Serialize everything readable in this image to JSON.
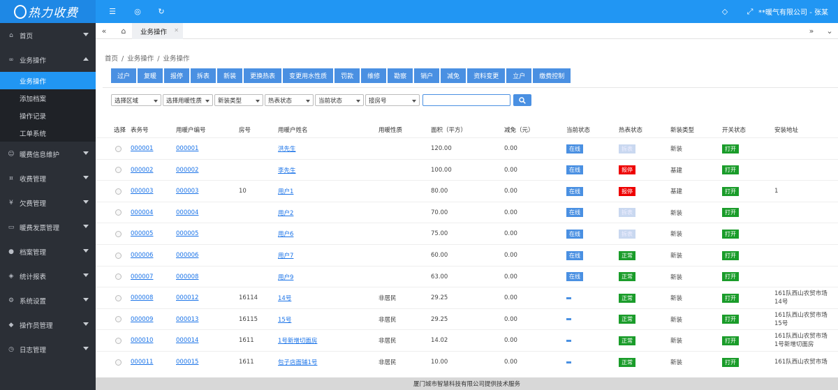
{
  "app": {
    "title": "热力收费",
    "company_user": "**暖气有限公司 - 张某"
  },
  "colors": {
    "primary": "#2196f3",
    "sidebar": "#2b2f36",
    "button": "#4a90e2",
    "danger": "#e00000",
    "success": "#1a9c2a"
  },
  "sidebar": {
    "items": [
      {
        "icon": "home-icon",
        "label": "首页"
      },
      {
        "icon": "link-icon",
        "label": "业务操作"
      },
      {
        "icon": "user-card-icon",
        "label": "暖费信息维护"
      },
      {
        "icon": "coin-icon",
        "label": "收费管理"
      },
      {
        "icon": "debt-icon",
        "label": "欠费管理"
      },
      {
        "icon": "invoice-icon",
        "label": "暖费发票管理"
      },
      {
        "icon": "person-icon",
        "label": "档案管理"
      },
      {
        "icon": "stats-icon",
        "label": "统计报表"
      },
      {
        "icon": "gear-icon",
        "label": "系统设置"
      },
      {
        "icon": "shield-icon",
        "label": "操作员管理"
      },
      {
        "icon": "clock-icon",
        "label": "日志管理"
      }
    ],
    "subitems": [
      "业务操作",
      "添加档案",
      "操作记录",
      "工单系统"
    ]
  },
  "tabbar": {
    "tab_label": "业务操作"
  },
  "breadcrumb": [
    "首页",
    "/",
    "业务操作",
    "/",
    "业务操作"
  ],
  "toolbar": [
    "过户",
    "复暖",
    "报停",
    "拆表",
    "新装",
    "更换热表",
    "变更用水性质",
    "罚款",
    "维修",
    "勘察",
    "销户",
    "减免",
    "资料变更",
    "立户",
    "缴费控制"
  ],
  "filters": [
    "选择区域",
    "选择用暖性质",
    "新装类型",
    "热表状态",
    "当前状态",
    "接房号"
  ],
  "table": {
    "headers": [
      "选择",
      "表务号",
      "用暖户编号",
      "房号",
      "用暖户姓名",
      "用暖性质",
      "面积（平方）",
      "减免（元）",
      "当前状态",
      "热表状态",
      "新装类型",
      "开关状态",
      "安装地址"
    ],
    "rows": [
      {
        "no": "000001",
        "user": "000001",
        "room": "",
        "name": "洪先生",
        "nature": "",
        "area": "120.00",
        "discount": "0.00",
        "cur": "在线",
        "meter": "拆表",
        "mtype": "pale",
        "install": "新装",
        "switch": "打开",
        "addr": ""
      },
      {
        "no": "000002",
        "user": "000002",
        "room": "",
        "name": "李先生",
        "nature": "",
        "area": "100.00",
        "discount": "0.00",
        "cur": "在线",
        "meter": "报停",
        "mtype": "red",
        "install": "基建",
        "switch": "打开",
        "addr": ""
      },
      {
        "no": "000003",
        "user": "000003",
        "room": "10",
        "name": "用户1",
        "nature": "",
        "area": "80.00",
        "discount": "0.00",
        "cur": "在线",
        "meter": "报停",
        "mtype": "red",
        "install": "基建",
        "switch": "打开",
        "addr": "1"
      },
      {
        "no": "000004",
        "user": "000004",
        "room": "",
        "name": "用户2",
        "nature": "",
        "area": "70.00",
        "discount": "0.00",
        "cur": "在线",
        "meter": "拆表",
        "mtype": "pale",
        "install": "新装",
        "switch": "打开",
        "addr": ""
      },
      {
        "no": "000005",
        "user": "000005",
        "room": "",
        "name": "用户6",
        "nature": "",
        "area": "75.00",
        "discount": "0.00",
        "cur": "在线",
        "meter": "拆表",
        "mtype": "pale",
        "install": "新装",
        "switch": "打开",
        "addr": ""
      },
      {
        "no": "000006",
        "user": "000006",
        "room": "",
        "name": "用户7",
        "nature": "",
        "area": "60.00",
        "discount": "0.00",
        "cur": "在线",
        "meter": "正常",
        "mtype": "green",
        "install": "新装",
        "switch": "打开",
        "addr": ""
      },
      {
        "no": "000007",
        "user": "000008",
        "room": "",
        "name": "用户9",
        "nature": "",
        "area": "63.00",
        "discount": "0.00",
        "cur": "在线",
        "meter": "正常",
        "mtype": "green",
        "install": "新装",
        "switch": "打开",
        "addr": ""
      },
      {
        "no": "000008",
        "user": "000012",
        "room": "16114",
        "name": "14号",
        "nature": "非居民",
        "area": "29.25",
        "discount": "0.00",
        "cur": "",
        "meter": "正常",
        "mtype": "green",
        "install": "新装",
        "switch": "打开",
        "addr": "161队西山农贸市场14号"
      },
      {
        "no": "000009",
        "user": "000013",
        "room": "16115",
        "name": "15号",
        "nature": "非居民",
        "area": "29.25",
        "discount": "0.00",
        "cur": "",
        "meter": "正常",
        "mtype": "green",
        "install": "新装",
        "switch": "打开",
        "addr": "161队西山农贸市场15号"
      },
      {
        "no": "000010",
        "user": "000014",
        "room": "1611",
        "name": "1号新增切面房",
        "nature": "非居民",
        "area": "14.02",
        "discount": "0.00",
        "cur": "",
        "meter": "正常",
        "mtype": "green",
        "install": "新装",
        "switch": "打开",
        "addr": "161队西山农贸市场1号新增切面房"
      },
      {
        "no": "000011",
        "user": "000015",
        "room": "1611",
        "name": "包子店面铺1号",
        "nature": "非居民",
        "area": "10.00",
        "discount": "0.00",
        "cur": "",
        "meter": "正常",
        "mtype": "green",
        "install": "新装",
        "switch": "打开",
        "addr": "161队西山农贸市场"
      }
    ]
  },
  "footer": "厦门城市智慧科技有限公司提供技术服务"
}
